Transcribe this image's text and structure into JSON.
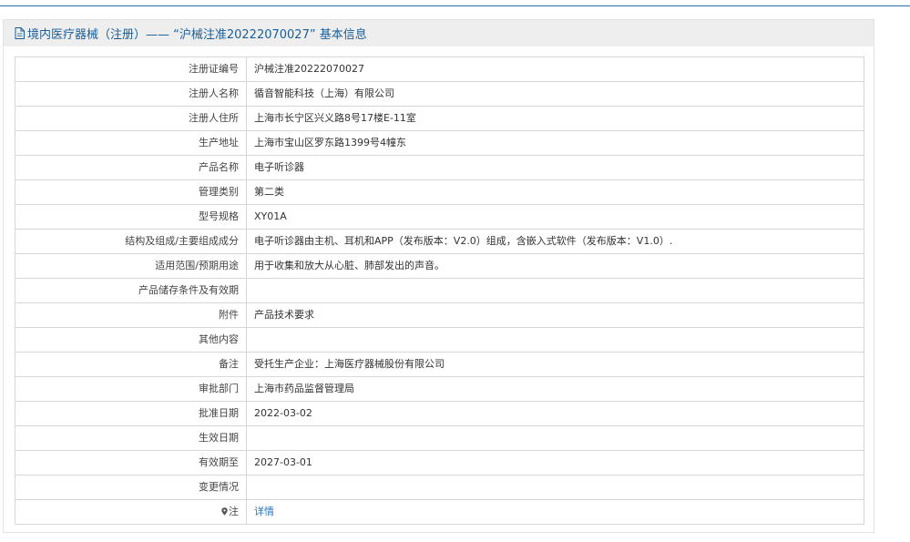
{
  "header": {
    "title": "境内医疗器械（注册）—— “沪械注准20222070027” 基本信息"
  },
  "rows": [
    {
      "label": "注册证编号",
      "value": "沪械注准20222070027"
    },
    {
      "label": "注册人名称",
      "value": "循音智能科技（上海）有限公司"
    },
    {
      "label": "注册人住所",
      "value": "上海市长宁区兴义路8号17楼E-11室"
    },
    {
      "label": "生产地址",
      "value": "上海市宝山区罗东路1399号4幢东"
    },
    {
      "label": "产品名称",
      "value": "电子听诊器"
    },
    {
      "label": "管理类别",
      "value": "第二类"
    },
    {
      "label": "型号规格",
      "value": "XY01A"
    },
    {
      "label": "结构及组成/主要组成成分",
      "value": "电子听诊器由主机、耳机和APP（发布版本：V2.0）组成，含嵌入式软件（发布版本：V1.0）."
    },
    {
      "label": "适用范围/预期用途",
      "value": "用于收集和放大从心脏、肺部发出的声音。"
    },
    {
      "label": "产品储存条件及有效期",
      "value": ""
    },
    {
      "label": "附件",
      "value": "产品技术要求"
    },
    {
      "label": "其他内容",
      "value": ""
    },
    {
      "label": "备注",
      "value": "受托生产企业：上海医疗器械股份有限公司"
    },
    {
      "label": "审批部门",
      "value": "上海市药品监督管理局"
    },
    {
      "label": "批准日期",
      "value": "2022-03-02"
    },
    {
      "label": "生效日期",
      "value": ""
    },
    {
      "label": "有效期至",
      "value": "2027-03-01"
    },
    {
      "label": "变更情况",
      "value": ""
    }
  ],
  "note": {
    "label": "注",
    "icon": "pin-icon",
    "link_text": "详情"
  },
  "colors": {
    "accent": "#1a5e9a",
    "link": "#2a73c1",
    "header_bg": "#eeeeee",
    "border": "#d6d6d6"
  }
}
